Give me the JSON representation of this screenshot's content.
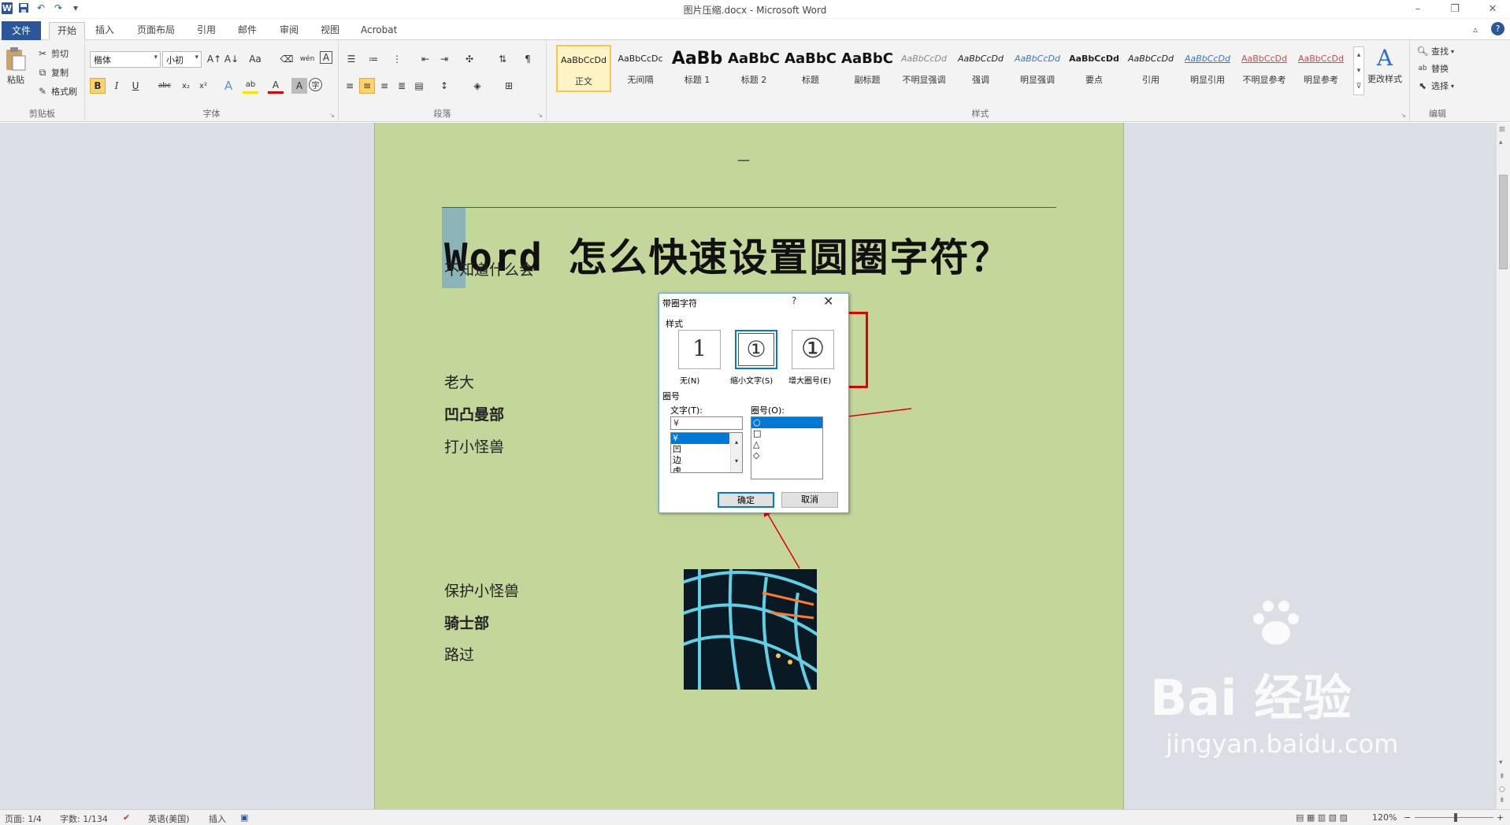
{
  "window": {
    "title": "图片压缩.docx - Microsoft Word",
    "controls": [
      "–",
      "❐",
      "✕"
    ]
  },
  "qat": {
    "logo": "W",
    "undo": "↶",
    "redo": "↷",
    "more": "▾"
  },
  "tabs": [
    "文件",
    "开始",
    "插入",
    "页面布局",
    "引用",
    "邮件",
    "审阅",
    "视图",
    "Acrobat"
  ],
  "ribbon": {
    "clipboard": {
      "paste": "粘贴",
      "cut": "剪切",
      "copy": "复制",
      "format_painter": "格式刷",
      "label": "剪贴板"
    },
    "font": {
      "font_name": "楷体",
      "font_size": "小初",
      "label": "字体",
      "bold": "B",
      "italic": "I",
      "underline": "U",
      "strike": "abc",
      "sub": "x₂",
      "sup": "x²",
      "grow": "A↑",
      "shrink": "A↓",
      "case": "Aa",
      "clear": "⌫",
      "phonetic": "wén",
      "border": "A",
      "effects": "A",
      "highlight": "ab",
      "color": "A",
      "shade": "A",
      "encircle": "字"
    },
    "paragraph": {
      "label": "段落"
    },
    "styles": {
      "label": "样式",
      "change": "更改样式",
      "items": [
        {
          "preview": "AaBbCcDd",
          "name": "正文"
        },
        {
          "preview": "AaBbCcDc",
          "name": "无间隔"
        },
        {
          "preview": "AaBb",
          "name": "标题 1"
        },
        {
          "preview": "AaBbC",
          "name": "标题 2"
        },
        {
          "preview": "AaBbC",
          "name": "标题"
        },
        {
          "preview": "AaBbC",
          "name": "副标题"
        },
        {
          "preview": "AaBbCcDd",
          "name": "不明显强调"
        },
        {
          "preview": "AaBbCcDd",
          "name": "强调"
        },
        {
          "preview": "AaBbCcDd",
          "name": "明显强调"
        },
        {
          "preview": "AaBbCcDd",
          "name": "要点"
        },
        {
          "preview": "AaBbCcDd",
          "name": "引用"
        },
        {
          "preview": "AaBbCcDd",
          "name": "明显引用"
        },
        {
          "preview": "AaBbCcDd",
          "name": "不明显参考"
        },
        {
          "preview": "AaBbCcDd",
          "name": "明显参考"
        }
      ]
    },
    "editing": {
      "find": "查找",
      "replace": "替换",
      "select": "选择",
      "label": "编辑"
    }
  },
  "document": {
    "header_mark": "一",
    "title": "Word 怎么快速设置圆圈字符？",
    "lines": [
      "不知道什么会",
      "老大",
      "凹凸曼部",
      "打小怪兽",
      "保护小怪兽",
      "骑士部",
      "路过"
    ]
  },
  "dialog": {
    "title": "带圈字符",
    "help": "?",
    "close": "✕",
    "style_label": "样式",
    "styles": [
      {
        "glyph": "1",
        "label": "无(N)"
      },
      {
        "glyph": "①",
        "label": "缩小文字(S)"
      },
      {
        "glyph": "①",
        "label": "增大圈号(E)"
      }
    ],
    "enclosure_label": "圈号",
    "text_label": "文字(T):",
    "text_value": "¥",
    "text_items": [
      "¥",
      "凹",
      "边",
      "虑"
    ],
    "circle_label": "圈号(O):",
    "circle_items": [
      "○",
      "□",
      "△",
      "◇"
    ],
    "ok": "确定",
    "cancel": "取消"
  },
  "status": {
    "page": "页面: 1/4",
    "words": "字数: 1/134",
    "lang": "英语(美国)",
    "mode": "插入",
    "zoom": "120%",
    "zoom_minus": "−",
    "zoom_plus": "+"
  },
  "watermark": {
    "brand": "Bai 经验",
    "url": "jingyan.baidu.com"
  },
  "colors": {
    "accent": "#2b579a",
    "page": "#c4d79b",
    "annotation": "#e00000",
    "selection": "#0078d7"
  }
}
